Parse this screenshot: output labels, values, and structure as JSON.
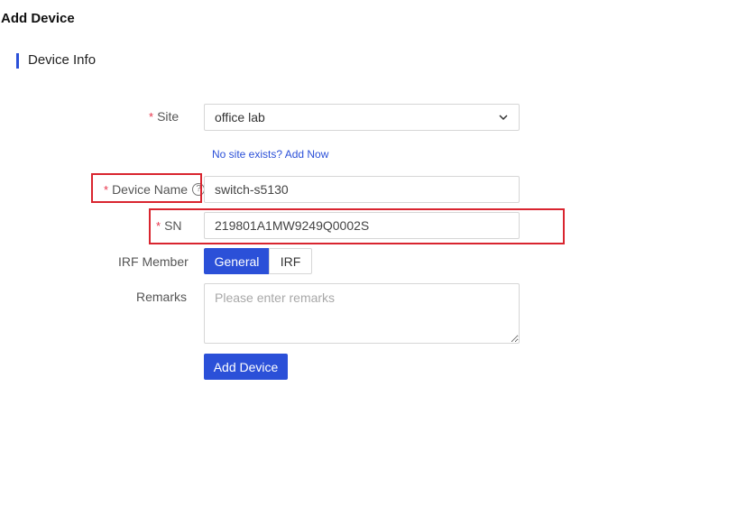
{
  "page": {
    "title": "Add Device"
  },
  "section": {
    "title": "Device Info"
  },
  "form": {
    "site": {
      "label": "Site",
      "value": "office lab",
      "add_link": "No site exists? Add Now"
    },
    "device_name": {
      "label": "Device Name",
      "value": "switch-s5130",
      "help_icon": "question-circle-icon"
    },
    "sn": {
      "label": "SN",
      "value": "219801A1MW9249Q0002S"
    },
    "irf_member": {
      "label": "IRF Member",
      "options": [
        "General",
        "IRF"
      ],
      "selected": "General"
    },
    "remarks": {
      "label": "Remarks",
      "placeholder": "Please enter remarks"
    },
    "submit_label": "Add Device",
    "required_mark": "*"
  },
  "colors": {
    "accent": "#2b50d8",
    "required": "#e8334a",
    "highlight": "#d9252f"
  }
}
